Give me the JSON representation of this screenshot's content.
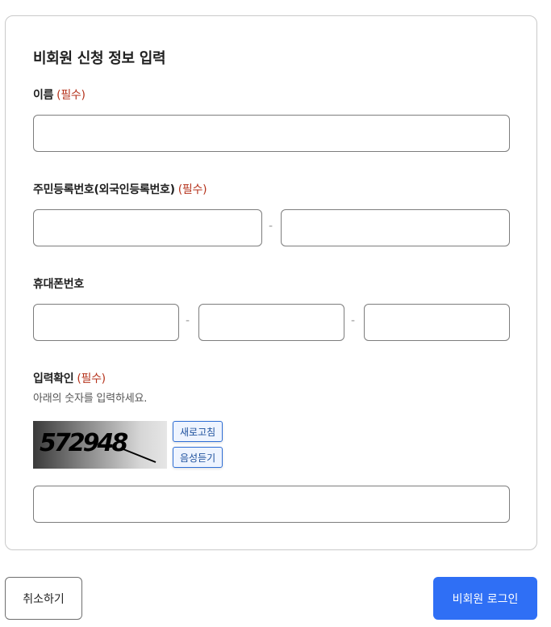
{
  "form": {
    "title": "비회원 신청 정보 입력",
    "required_mark": "(필수)",
    "name": {
      "label": "이름",
      "value": ""
    },
    "rrn": {
      "label": "주민등록번호(외국인등록번호)",
      "part1": "",
      "part2": "",
      "separator": "-"
    },
    "phone": {
      "label": "휴대폰번호",
      "part1": "",
      "part2": "",
      "part3": "",
      "separator": "-"
    },
    "captcha": {
      "label": "입력확인",
      "hint": "아래의 숫자를 입력하세요.",
      "image_text": "572948",
      "refresh_label": "새로고침",
      "audio_label": "음성듣기",
      "value": ""
    }
  },
  "actions": {
    "cancel_label": "취소하기",
    "login_label": "비회원 로그인"
  },
  "colors": {
    "primary": "#2f6ff5",
    "required": "#b5331c",
    "border": "#7d7d7d"
  }
}
